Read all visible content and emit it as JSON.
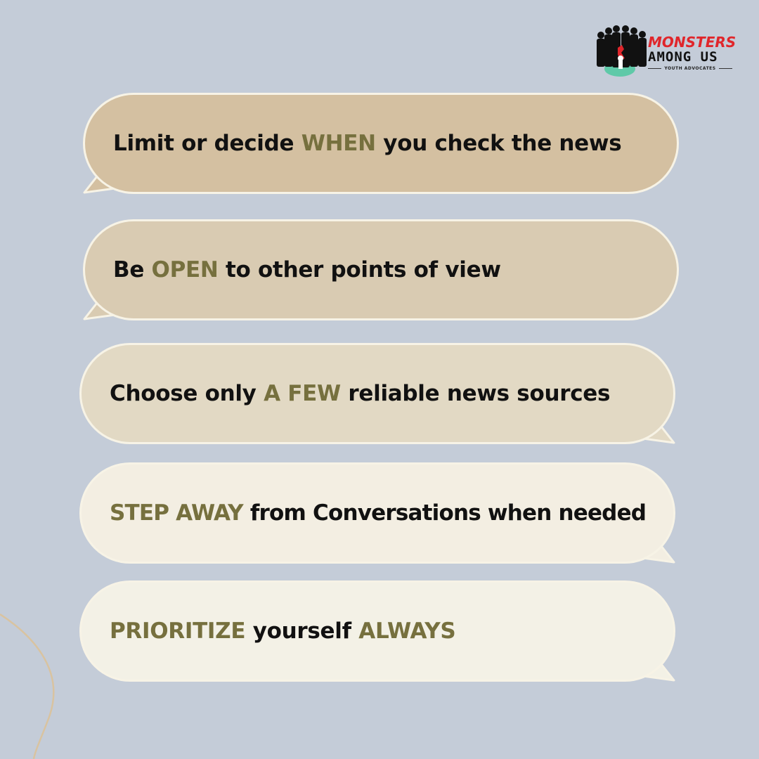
{
  "logo": {
    "line1": "MONSTERS",
    "line2": "AMONG US",
    "line3": "YOUTH ADVOCATES"
  },
  "tips": [
    {
      "pre": "Limit or decide ",
      "hl": "WHEN",
      "post": " you check the news",
      "color": "#d4c0a1"
    },
    {
      "pre": "Be ",
      "hl": "OPEN",
      "post": " to other points of view",
      "color": "#d9cbb2"
    },
    {
      "pre": "Choose only ",
      "hl": "A FEW",
      "post": " reliable news sources",
      "color": "#e2d9c4"
    },
    {
      "hl_first": "STEP AWAY",
      "post": " from Conversations when needed",
      "color": "#f3eee2"
    },
    {
      "hl_first": "PRIORITIZE",
      "mid": " yourself ",
      "hl_last": "ALWAYS",
      "color": "#f3f1e6"
    }
  ],
  "colors": {
    "background": "#c4ccd8",
    "highlight": "#76703e",
    "border": "#f7f3e6",
    "logo_red": "#e0262b"
  }
}
